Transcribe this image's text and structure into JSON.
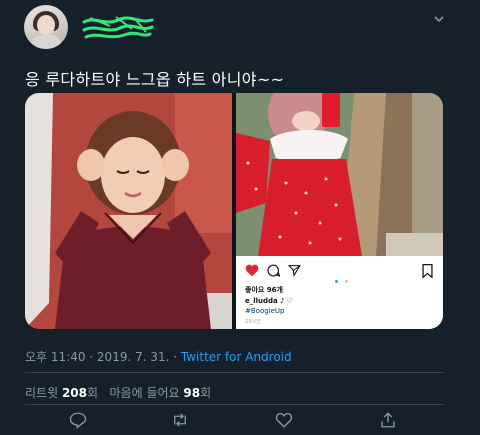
{
  "tweet": {
    "text": "응 루다하트야 느그옵 하트 아니야~~",
    "timestamp": "오후 11:40 · 2019. 7. 31. · ",
    "source": "Twitter for Android",
    "retweet_count": "208",
    "retweet_label": "리트윗",
    "count_suffix": "회",
    "like_count": "98",
    "like_label": "마음에 들어요"
  },
  "instagram": {
    "likes": "좋아요 96개",
    "username": "e_lludda",
    "caption_symbols": "♪ ♡",
    "hashtag": "#BoogieUp",
    "time": "23시간"
  },
  "colors": {
    "background": "#15202b",
    "accent": "#1da1f2",
    "secondary_text": "#8899a6",
    "divider": "#38444d"
  },
  "icons": {
    "more": "chevron-down-icon",
    "reply": "reply-icon",
    "retweet": "retweet-icon",
    "like": "heart-icon",
    "share": "share-icon"
  }
}
